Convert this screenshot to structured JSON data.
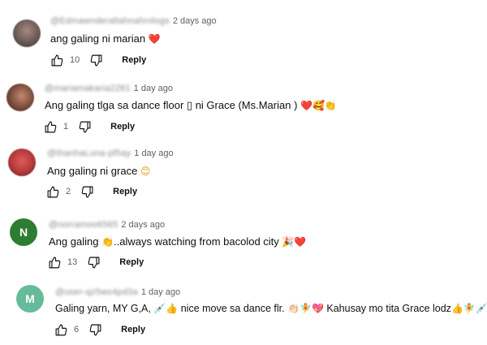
{
  "comments": [
    {
      "handle": "@Edmawnderaltahnahrologs",
      "time": "2 days ago",
      "text": "ang galing ni marian",
      "emoji_after": "❤️",
      "likes": "10",
      "reply_label": "Reply",
      "avatar_color": "#6b5a55"
    },
    {
      "handle": "@mariamakaria2281",
      "time": "1 day ago",
      "text": "Ang galing tlga sa dance floor",
      "box_glyph": "▯",
      "text_cont": "ni Grace (Ms.Marian )",
      "emoji_after": "❤️🥰👏",
      "likes": "1",
      "reply_label": "Reply",
      "avatar_color": "#7a4a3a"
    },
    {
      "handle": "@thanhaLuna-pf5ay",
      "time": "1 day ago",
      "text": "Ang galing ni grace",
      "emoji_after": "😊",
      "likes": "2",
      "reply_label": "Reply",
      "avatar_color": "#b23a3a"
    },
    {
      "handle": "@norramoo6565",
      "time": "2 days ago",
      "text": "Ang galing",
      "emoji_mid": "👏",
      "text_cont": "..always watching from bacolod city",
      "emoji_after": "🎉❤️",
      "likes": "13",
      "reply_label": "Reply",
      "avatar_letter": "N",
      "avatar_color": "#2e7d32"
    },
    {
      "handle": "@user-qz5wo4pd3a",
      "time": "1 day ago",
      "text": "Galing yarn, MY G,A,",
      "emoji_mid": "💉👍",
      "text_cont": "nice move sa dance flr.",
      "emoji_mid2": "👏🏻🧚💖",
      "text_cont2": "Kahusay mo tita Grace  lodz",
      "emoji_after": "👍🧚💉",
      "likes": "6",
      "reply_label": "Reply",
      "avatar_letter": "M",
      "avatar_color": "#66bb9a"
    }
  ],
  "colors": {
    "text": "#0f0f0f",
    "secondary": "#606060",
    "heart": "#e53935"
  },
  "icons": [
    "thumbs-up-icon",
    "thumbs-down-icon"
  ]
}
